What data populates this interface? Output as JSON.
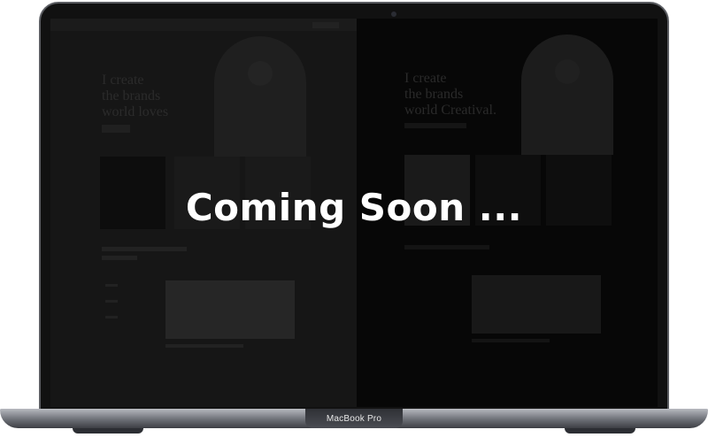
{
  "overlay": {
    "headline": "Coming Soon ..."
  },
  "device": {
    "brand_label": "MacBook Pro"
  },
  "preview": {
    "left_hero_lines": [
      "I create",
      "the brands",
      "world loves"
    ],
    "right_hero_lines": [
      "I create",
      "the brands",
      "world Creatival."
    ]
  }
}
